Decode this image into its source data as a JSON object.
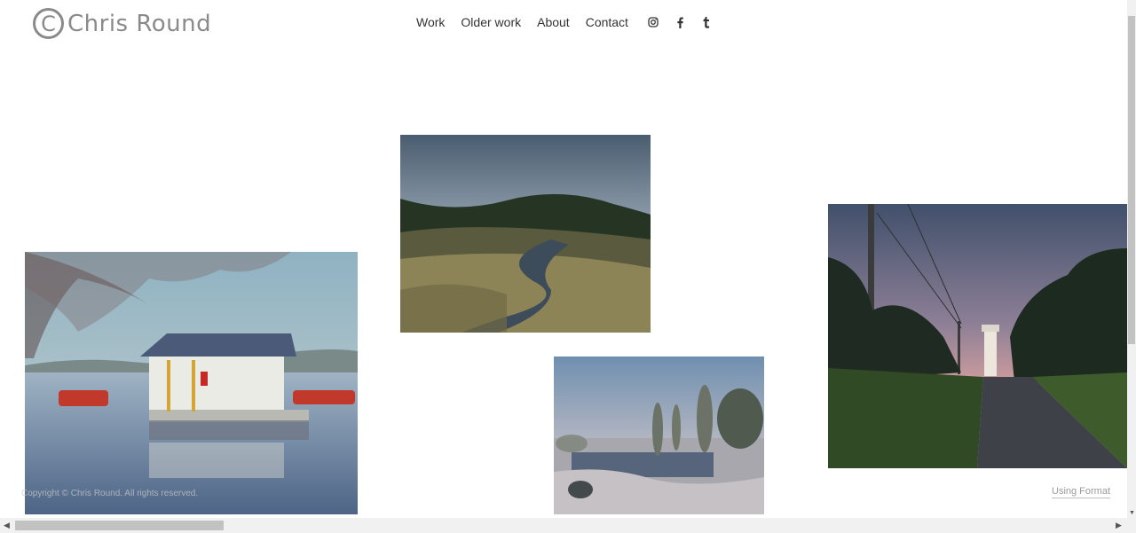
{
  "site": {
    "logo_mark": "C",
    "logo_text": "Chris Round"
  },
  "nav": {
    "items": [
      "Work",
      "Older work",
      "About",
      "Contact"
    ],
    "social_icons": [
      "instagram-icon",
      "facebook-icon",
      "tumblr-icon"
    ]
  },
  "gallery": {
    "photos": [
      {
        "name": "boathouse-photo",
        "subject": "Boathouse on a calm lake with red pedal boats"
      },
      {
        "name": "alpine-stream-photo",
        "subject": "Winding stream through highland grassland under cloudy sky"
      },
      {
        "name": "frosty-pond-photo",
        "subject": "Misty frosty pond with poplar trees"
      },
      {
        "name": "lighthouse-road-photo",
        "subject": "Road at dusk with a lighthouse and power poles"
      }
    ]
  },
  "footer": {
    "copyright": "Copyright © Chris Round. All rights reserved.",
    "using_format": "Using Format"
  },
  "colors": {
    "logo": "#8a8a8a",
    "nav_text": "#333333",
    "scrollbar_thumb": "#c2c2c2"
  }
}
